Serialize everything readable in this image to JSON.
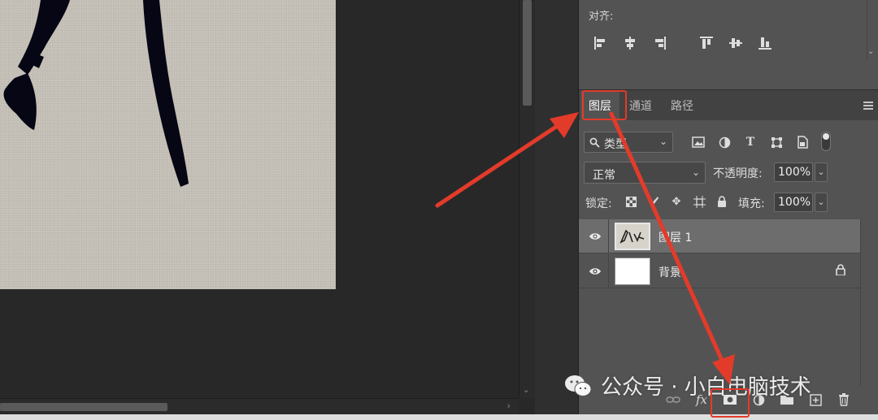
{
  "align_panel": {
    "title": "对齐:"
  },
  "layers_panel": {
    "tabs": [
      {
        "label": "图层",
        "active": true
      },
      {
        "label": "通道",
        "active": false
      },
      {
        "label": "路径",
        "active": false
      }
    ],
    "filter": {
      "selected": "类型"
    },
    "blend_mode": {
      "selected": "正常"
    },
    "opacity": {
      "label": "不透明度:",
      "value": "100%"
    },
    "lock": {
      "label": "锁定:"
    },
    "fill": {
      "label": "填充:",
      "value": "100%"
    },
    "layers": [
      {
        "name": "图层 1",
        "visible": true,
        "selected": true,
        "locked": false
      },
      {
        "name": "背景",
        "visible": true,
        "selected": false,
        "locked": true
      }
    ],
    "footer_icons": [
      "link-icon",
      "fx-icon",
      "mask-icon",
      "adjustment-icon",
      "folder-icon",
      "new-layer-icon",
      "trash-icon"
    ]
  },
  "watermark": {
    "text": "公众号 · 小白电脑技术"
  },
  "colors": {
    "panel_bg": "#535353",
    "tab_bg": "#424242",
    "canvas_bg": "#282828",
    "annotation": "#e33b2a",
    "selected_layer": "#6d6d6d"
  }
}
